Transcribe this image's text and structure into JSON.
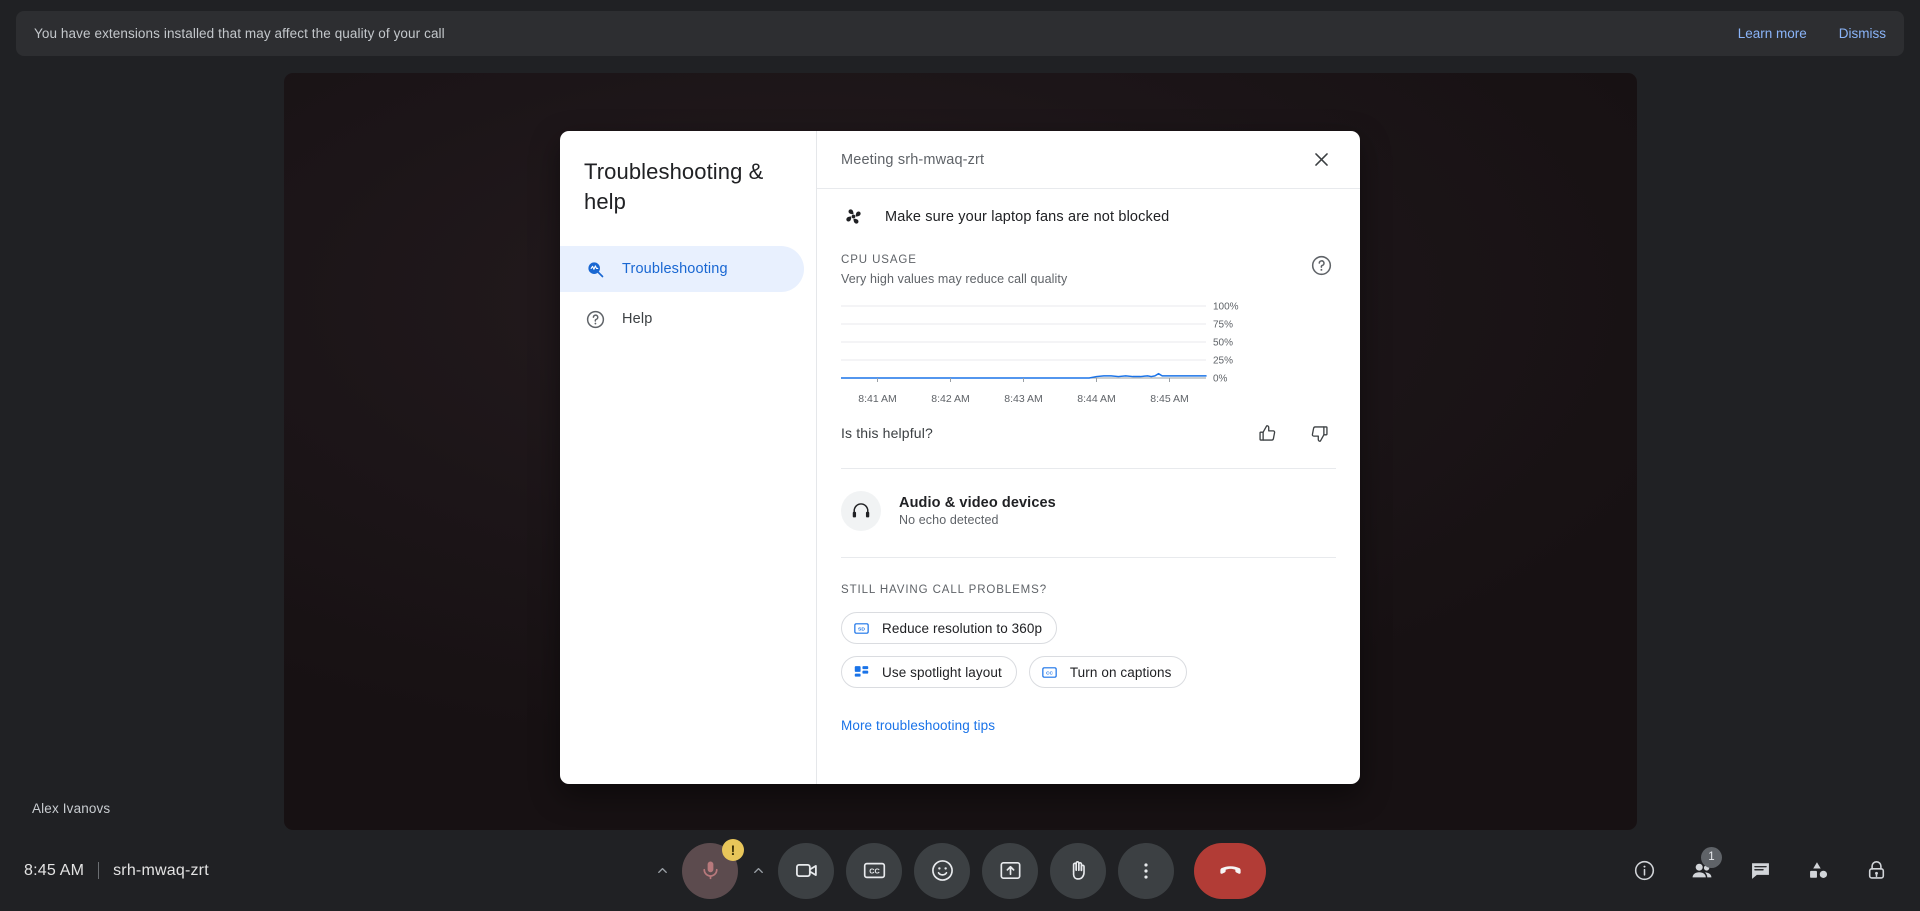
{
  "banner": {
    "message": "You have extensions installed that may affect the quality of your call",
    "learn_more": "Learn more",
    "dismiss": "Dismiss"
  },
  "stage": {
    "participant_name": "Alex Ivanovs"
  },
  "bottom_bar": {
    "time": "8:45 AM",
    "meeting_code": "srh-mwaq-zrt",
    "controls": [
      {
        "name": "mic-options-chevron",
        "icon": "chevron-up-icon"
      },
      {
        "name": "microphone-button",
        "icon": "microphone-icon",
        "badge": "!"
      },
      {
        "name": "camera-options-chevron",
        "icon": "chevron-up-icon"
      },
      {
        "name": "camera-button",
        "icon": "video-camera-icon"
      },
      {
        "name": "captions-button",
        "icon": "closed-captions-icon"
      },
      {
        "name": "reactions-button",
        "icon": "emoji-smiley-icon"
      },
      {
        "name": "present-button",
        "icon": "present-screen-icon"
      },
      {
        "name": "raise-hand-button",
        "icon": "raised-hand-icon"
      },
      {
        "name": "more-options-button",
        "icon": "three-dots-vertical-icon"
      },
      {
        "name": "leave-call-button",
        "icon": "phone-hangup-icon"
      }
    ],
    "right_controls": [
      {
        "name": "meeting-details-button",
        "icon": "info-circle-icon"
      },
      {
        "name": "people-button",
        "icon": "people-icon",
        "badge": "1"
      },
      {
        "name": "chat-button",
        "icon": "chat-bubble-icon"
      },
      {
        "name": "activities-button",
        "icon": "activities-shapes-icon"
      },
      {
        "name": "host-controls-button",
        "icon": "lock-shield-icon"
      }
    ]
  },
  "dialog": {
    "title": "Troubleshooting & help",
    "nav": [
      {
        "label": "Troubleshooting",
        "icon": "troubleshooting-search-icon",
        "active": true
      },
      {
        "label": "Help",
        "icon": "help-circle-icon",
        "active": false
      }
    ],
    "meeting_title": "Meeting srh-mwaq-zrt",
    "close_label": "Close",
    "tip": {
      "icon": "fan-icon",
      "text": "Make sure your laptop fans are not blocked"
    },
    "cpu": {
      "label": "CPU usage",
      "subtitle": "Very high values may reduce call quality",
      "help_icon": "help-circle-outline-icon"
    },
    "helpful": {
      "question": "Is this helpful?",
      "thumb_up": "thumb-up-icon",
      "thumb_down": "thumb-down-icon"
    },
    "devices": {
      "icon": "headset-icon",
      "title": "Audio & video devices",
      "status": "No echo detected"
    },
    "problems": {
      "label": "Still having call problems?",
      "chips": [
        {
          "label": "Reduce resolution to 360p",
          "icon": "sd-resolution-icon"
        },
        {
          "label": "Use spotlight layout",
          "icon": "spotlight-layout-icon"
        },
        {
          "label": "Turn on captions",
          "icon": "closed-captions-icon"
        }
      ],
      "more_link": "More troubleshooting tips"
    }
  },
  "chart_data": {
    "type": "line",
    "title": "CPU usage",
    "subtitle": "Very high values may reduce call quality",
    "xlabel": "",
    "ylabel": "",
    "ylim": [
      0,
      100
    ],
    "ytick_labels": [
      "0%",
      "25%",
      "50%",
      "75%",
      "100%"
    ],
    "ytick_values": [
      0,
      25,
      50,
      75,
      100
    ],
    "xtick_labels": [
      "8:41 AM",
      "8:42 AM",
      "8:43 AM",
      "8:44 AM",
      "8:45 AM"
    ],
    "grid": true,
    "legend": "none",
    "line_color": "#1a73e8",
    "series": [
      {
        "name": "CPU usage",
        "x": [
          0,
          8,
          16,
          24,
          32,
          40,
          48,
          56,
          64,
          68,
          70,
          72,
          74,
          76,
          78,
          80,
          82,
          84,
          85,
          86,
          87,
          88,
          89,
          90,
          92,
          94,
          96,
          98,
          100
        ],
        "values": [
          0,
          0,
          0,
          0,
          0,
          0,
          0,
          0,
          0,
          0,
          2,
          3,
          3,
          2,
          3,
          2,
          2,
          3,
          2,
          3,
          6,
          3,
          3,
          3,
          3,
          3,
          3,
          3,
          3
        ]
      }
    ]
  }
}
